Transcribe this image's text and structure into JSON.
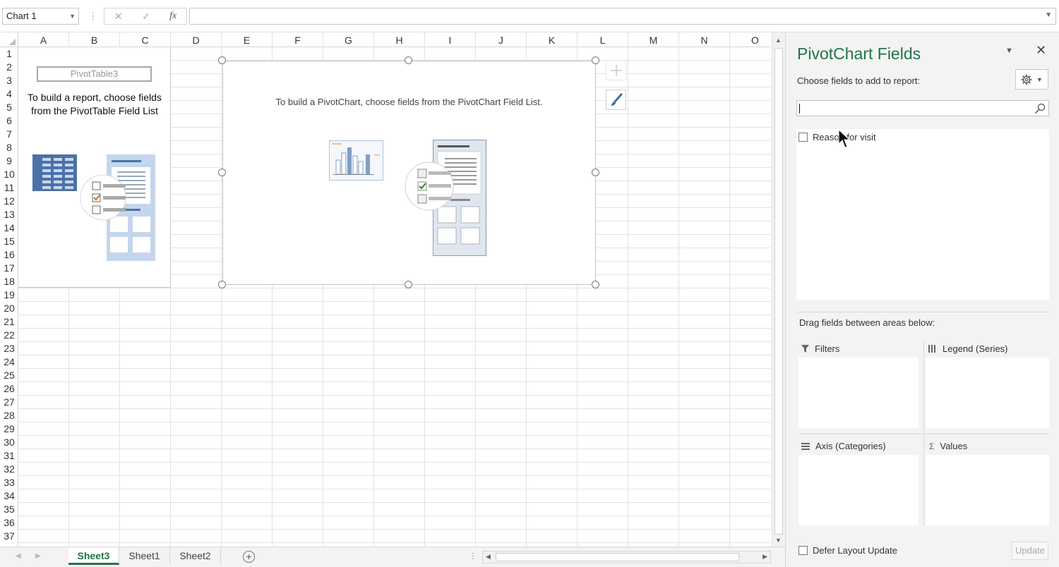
{
  "formula_bar": {
    "name_box": "Chart 1",
    "cancel_icon": "✕",
    "enter_icon": "✓",
    "fx_label": "fx",
    "formula_value": ""
  },
  "grid": {
    "columns": [
      "A",
      "B",
      "C",
      "D",
      "E",
      "F",
      "G",
      "H",
      "I",
      "J",
      "K",
      "L",
      "M",
      "N",
      "O"
    ],
    "rows": [
      "1",
      "2",
      "3",
      "4",
      "5",
      "6",
      "7",
      "8",
      "9",
      "10",
      "11",
      "12",
      "13",
      "14",
      "15",
      "16",
      "17",
      "18",
      "19",
      "20",
      "21",
      "22",
      "23",
      "24",
      "25",
      "26",
      "27",
      "28",
      "29",
      "30",
      "31",
      "32",
      "33",
      "34",
      "35",
      "36",
      "37"
    ]
  },
  "pivot_table": {
    "name": "PivotTable3",
    "message_line1": "To build a report, choose fields",
    "message_line2": "from the PivotTable Field List"
  },
  "chart": {
    "message": "To build a PivotChart, choose fields from the PivotChart Field List."
  },
  "sheet_tabs": [
    {
      "label": "Sheet3",
      "active": true
    },
    {
      "label": "Sheet1",
      "active": false
    },
    {
      "label": "Sheet2",
      "active": false
    }
  ],
  "panel": {
    "title": "PivotChart Fields",
    "choose_label": "Choose fields to add to report:",
    "search_placeholder": "",
    "fields": [
      {
        "label": "Reason for visit",
        "checked": false
      }
    ],
    "drag_label": "Drag fields between areas below:",
    "areas": {
      "filters": "Filters",
      "legend": "Legend (Series)",
      "axis": "Axis (Categories)",
      "values": "Values"
    },
    "defer_label": "Defer Layout Update",
    "update_label": "Update"
  },
  "colors": {
    "accent": "#217346",
    "chart_bar": "#7f9fc8",
    "check_green": "#3f8f3f"
  }
}
